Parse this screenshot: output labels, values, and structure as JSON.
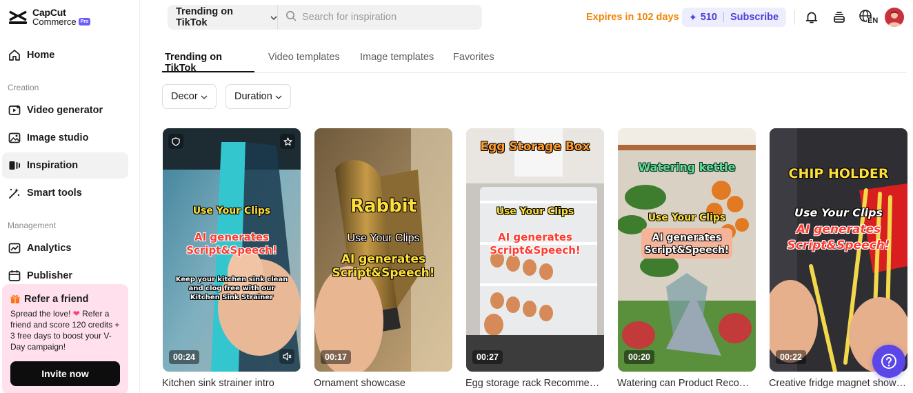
{
  "brand": {
    "line1": "CapCut",
    "line2": "Commerce",
    "badge": "Pro"
  },
  "sidebar": {
    "items": [
      {
        "label": "Home",
        "icon": "home-icon"
      },
      {
        "label": "Video generator",
        "icon": "video-generator-icon"
      },
      {
        "label": "Image studio",
        "icon": "image-studio-icon"
      },
      {
        "label": "Inspiration",
        "icon": "inspiration-icon",
        "active": true
      },
      {
        "label": "Smart tools",
        "icon": "magic-wand-icon"
      },
      {
        "label": "Analytics",
        "icon": "analytics-icon"
      },
      {
        "label": "Publisher",
        "icon": "calendar-icon"
      }
    ],
    "sections": {
      "creation": "Creation",
      "management": "Management"
    },
    "refer": {
      "title": "Refer a friend",
      "body_part1": "Spread the love! ",
      "body_part2": " Refer a friend and score 120 credits + 3 free days to boost your V-Day campaign!",
      "button": "Invite now"
    }
  },
  "header": {
    "search_scope": "Trending on TikTok",
    "search_placeholder": "Search for inspiration",
    "expires": "Expires in 102 days",
    "credits": "510",
    "subscribe": "Subscribe",
    "language": "EN"
  },
  "tabs": [
    {
      "label": "Trending on TikTok",
      "active": true
    },
    {
      "label": "Video templates"
    },
    {
      "label": "Image templates"
    },
    {
      "label": "Favorites"
    }
  ],
  "filters": {
    "decor": "Decor",
    "duration": "Duration"
  },
  "cards": [
    {
      "duration": "00:24",
      "title": "Kitchen sink strainer intro",
      "overlay": {
        "l1": "Use Your Clips",
        "l2": "AI generates",
        "l3": "Script&Speech!",
        "l4": "Keep your kitchen sink clean",
        "l5": "and clog free with our",
        "l6": "Kitchen Sink Strainer"
      }
    },
    {
      "duration": "00:17",
      "title": "Ornament showcase",
      "overlay": {
        "l1": "Rabbit",
        "l2": "Use Your Clips",
        "l3": "AI generates",
        "l4": "Script&Speech!"
      }
    },
    {
      "duration": "00:27",
      "title": "Egg storage rack Recommendation",
      "overlay": {
        "l1": "Egg Storage Box",
        "l2": "Use Your Clips",
        "l3": "AI generates",
        "l4": "Script&Speech!"
      }
    },
    {
      "duration": "00:20",
      "title": "Watering can Product Recommendation",
      "overlay": {
        "l1": "Watering kettle",
        "l2": "Use Your Clips",
        "l3": "AI generates",
        "l4": "Script&Speech!"
      }
    },
    {
      "duration": "00:22",
      "title": "Creative fridge magnet showcase",
      "overlay": {
        "l1": "CHIP HOLDER",
        "l2": "Use Your Clips",
        "l3": "AI generates",
        "l4": "Script&Speech!"
      }
    }
  ],
  "colors": {
    "accent": "#5b46e8",
    "expires": "#f0860a",
    "refer_bg": "#ffe0ec"
  }
}
